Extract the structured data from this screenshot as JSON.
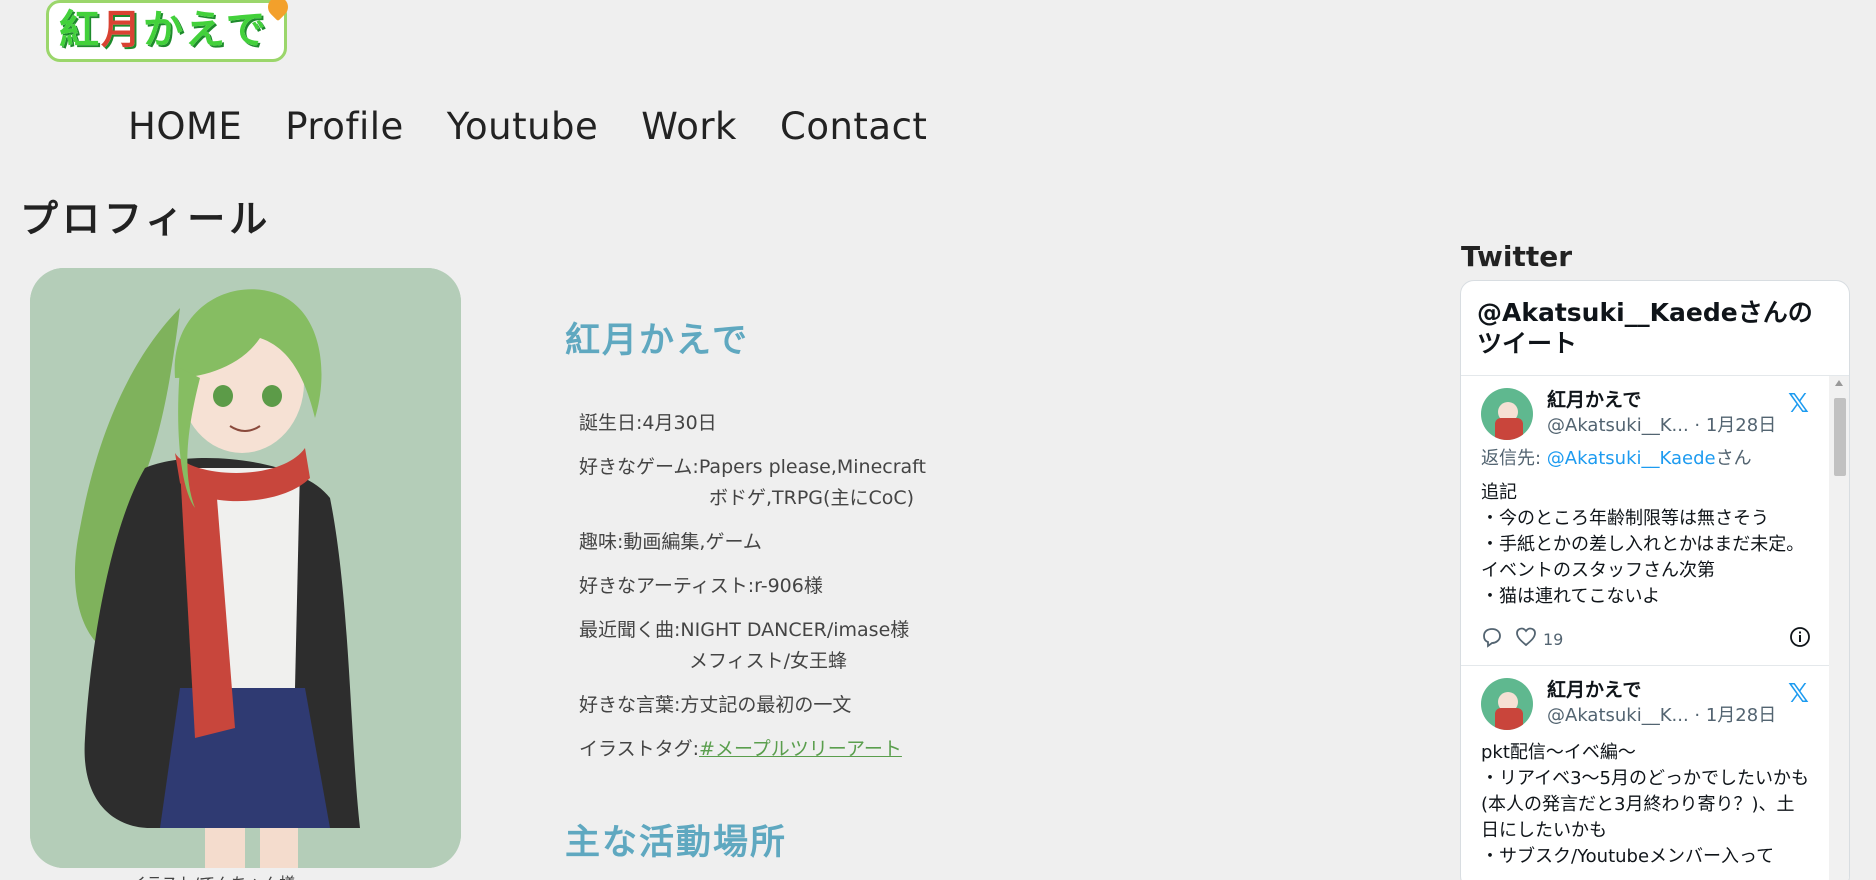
{
  "logo": {
    "part1": "紅",
    "part2": "月",
    "part3": "かえで"
  },
  "nav": [
    "HOME",
    "Profile",
    "Youtube",
    "Work",
    "Contact"
  ],
  "page_title": "プロフィール",
  "portrait_caption": "イラスト/てんちゃん様",
  "profile": {
    "name": "紅月かえで",
    "items": [
      {
        "line1": "誕生日:4月30日"
      },
      {
        "line1": "好きなゲーム:Papers please,Minecraft",
        "line2": "ボドゲ,TRPG(主にCoC)"
      },
      {
        "line1": "趣味:動画編集,ゲーム"
      },
      {
        "line1": "好きなアーティスト:r-906様"
      },
      {
        "line1": "最近聞く曲:NIGHT DANCER/imase様",
        "line2": "メフィスト/女王蜂"
      },
      {
        "line1": "好きな言葉:方丈記の最初の一文"
      }
    ],
    "tag_label": "イラストタグ:",
    "tag_value": "#メープルツリーアート",
    "section_heading": "主な活動場所"
  },
  "twitter": {
    "label": "Twitter",
    "widget_title": "@Akatsuki__Kaedeさんのツイート",
    "tweets": [
      {
        "name": "紅月かえで",
        "handle": "@Akatsuki__K... · 1月28日",
        "reply_prefix": "返信先: ",
        "reply_user": "@Akatsuki__Kaede",
        "reply_suffix": "さん",
        "body": "追記\n・今のところ年齢制限等は無さそう\n・手紙とかの差し入れとかはまだ未定。イベントのスタッフさん次第\n・猫は連れてこないよ",
        "likes": "19"
      },
      {
        "name": "紅月かえで",
        "handle": "@Akatsuki__K... · 1月28日",
        "body": "pkt配信〜イベ編〜\n・リアイベ3〜5月のどっかでしたいかも(本人の発言だと3月終わり寄り？)、土日にしたいかも\n・サブスク/Youtubeメンバー入って"
      }
    ]
  },
  "colors": {
    "background": "#efefef",
    "accent_blue": "#5fa8c0",
    "tag_green": "#5a9e4d",
    "twitter_blue": "#1d9bf0"
  },
  "icons": [
    "x-logo-icon",
    "reply-icon",
    "heart-icon",
    "info-icon"
  ]
}
